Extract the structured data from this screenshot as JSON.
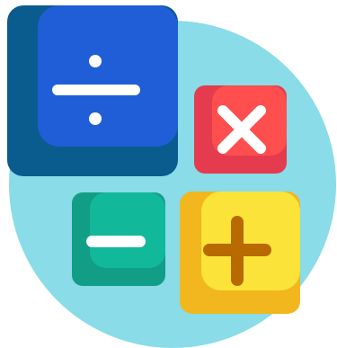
{
  "icon": {
    "icon_name": "math-operations-icon",
    "colors": {
      "background_circle": "#89DCE8",
      "divide_tile_dark": "#0A5B8E",
      "divide_tile_light": "#1F5ED7",
      "multiply_tile_dark": "#E53B4E",
      "multiply_tile_light": "#FF4E4E",
      "minus_tile_dark": "#129D86",
      "minus_tile_light": "#12B89A",
      "plus_tile_dark": "#F2B61F",
      "plus_tile_light": "#FBE33A",
      "plus_symbol": "#B86A00",
      "symbol_light": "#FFFFFF"
    },
    "tiles": [
      {
        "name": "divide-icon"
      },
      {
        "name": "multiply-icon"
      },
      {
        "name": "minus-icon"
      },
      {
        "name": "plus-icon"
      }
    ]
  }
}
